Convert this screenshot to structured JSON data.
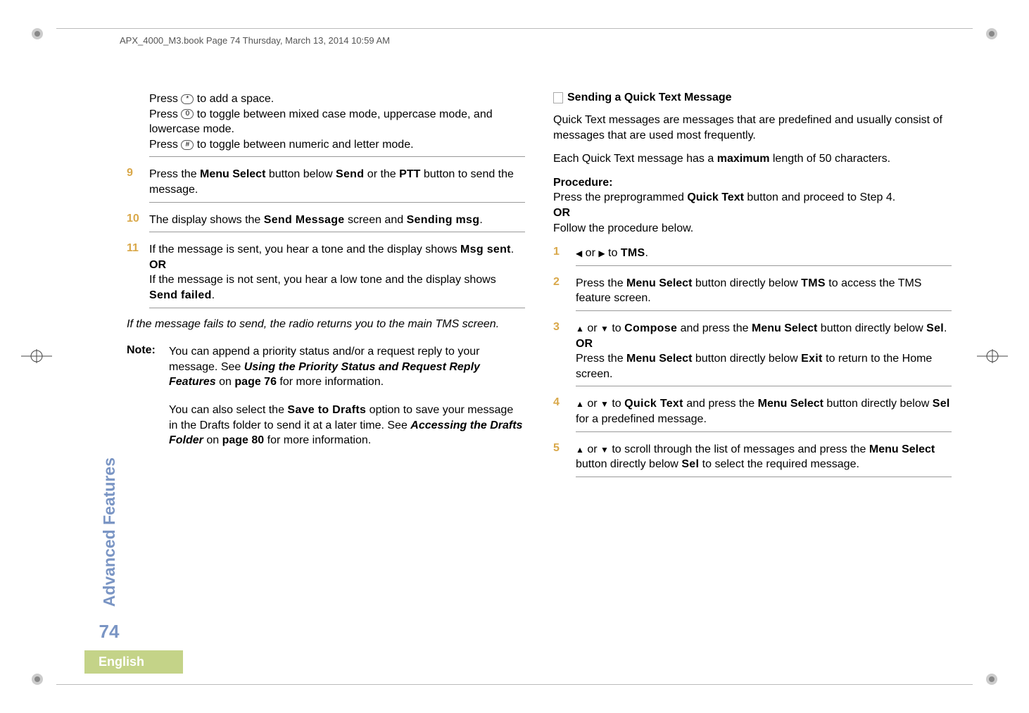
{
  "header": "APX_4000_M3.book  Page 74  Thursday, March 13, 2014  10:59 AM",
  "sidebar": {
    "section": "Advanced Features",
    "page": "74"
  },
  "footer": {
    "language": "English"
  },
  "keys": {
    "star": "*",
    "zero": "0",
    "hash": "#"
  },
  "left": {
    "p1a": "Press ",
    "p1b": " to add a space.",
    "p2a": "Press ",
    "p2b": " to toggle between mixed case mode, uppercase mode, and lowercase mode.",
    "p3a": "Press ",
    "p3b": " to toggle between numeric and letter mode.",
    "s9": {
      "num": "9",
      "a": "Press the ",
      "menu": "Menu Select",
      "b": " button below ",
      "send": "Send",
      "c": " or the ",
      "ptt": "PTT",
      "d": " button to send the message."
    },
    "s10": {
      "num": "10",
      "a": "The display shows the ",
      "sm": "Send Message",
      "b": " screen and ",
      "sending": "Sending msg",
      "c": "."
    },
    "s11": {
      "num": "11",
      "a": "If the message is sent, you hear a tone and the display shows ",
      "sent": "Msg sent",
      "b": ".",
      "or": "OR",
      "c": "If the message is not sent, you hear a low tone and the display shows ",
      "failed": "Send failed",
      "d": "."
    },
    "fail": "If the message fails to send, the radio returns you to the main TMS screen.",
    "note": {
      "label": "Note:",
      "p1a": "You can append a priority status and/or a request reply to your message. See ",
      "ref1": "Using the Priority Status and Request Reply Features",
      "p1b": " on ",
      "pg1": "page 76",
      "p1c": " for more information.",
      "p2a": "You can also select the ",
      "save": "Save to Drafts",
      "p2b": " option to save your message in the Drafts folder to send it at a later time. See ",
      "ref2": "Accessing the Drafts Folder",
      "p2c": " on ",
      "pg2": "page 80",
      "p2d": " for more information."
    }
  },
  "right": {
    "title": "Sending a Quick Text Message",
    "intro": "Quick Text messages are messages that are predefined and usually consist of messages that are used most frequently.",
    "max_a": "Each Quick Text message has a ",
    "max_b": "maximum",
    "max_c": " length of 50 characters.",
    "proc_label": "Procedure:",
    "proc1a": "Press the preprogrammed ",
    "proc1b": "Quick Text",
    "proc1c": " button and proceed to Step 4.",
    "or": "OR",
    "proc2": "Follow the procedure below.",
    "s1": {
      "num": "1",
      "a": " or ",
      "b": " to ",
      "tms": "TMS",
      "c": "."
    },
    "s2": {
      "num": "2",
      "a": "Press the ",
      "menu": "Menu Select",
      "b": " button directly below ",
      "tms": "TMS",
      "c": " to access the TMS feature screen."
    },
    "s3": {
      "num": "3",
      "a": " or ",
      "b": " to ",
      "compose": "Compose",
      "c": " and press the ",
      "menu": "Menu Select",
      "d": " button directly below ",
      "sel": "Sel",
      "e": ".",
      "or": "OR",
      "f": "Press the ",
      "menu2": "Menu Select",
      "g": " button directly below ",
      "exit": "Exit",
      "h": " to return to the Home screen."
    },
    "s4": {
      "num": "4",
      "a": " or ",
      "b": " to ",
      "qt": "Quick Text",
      "c": " and press the ",
      "menu": "Menu Select",
      "d": " button directly below ",
      "sel": "Sel",
      "e": " for a predefined message."
    },
    "s5": {
      "num": "5",
      "a": " or ",
      "b": " to scroll through the list of messages and press the ",
      "menu": "Menu Select",
      "c": " button directly below ",
      "sel": "Sel",
      "d": " to select the required message."
    }
  }
}
